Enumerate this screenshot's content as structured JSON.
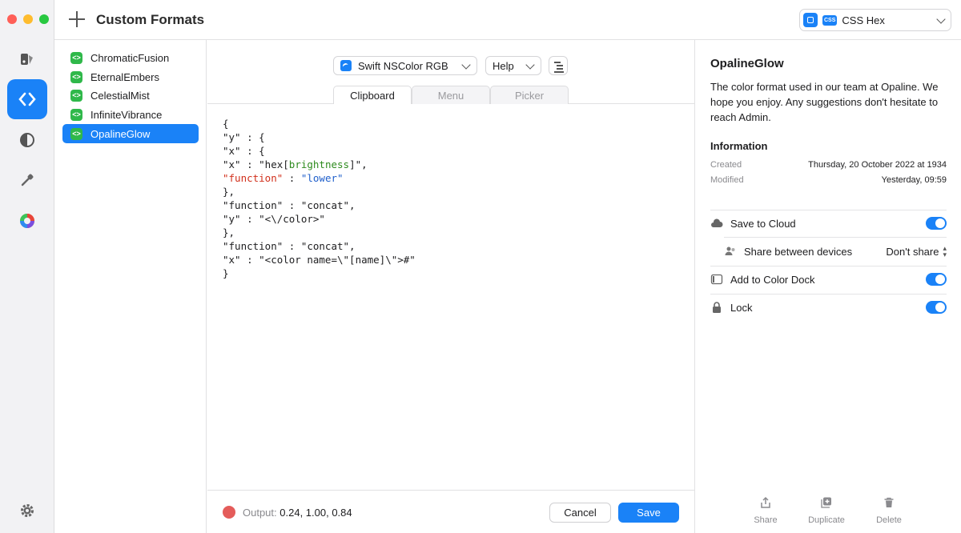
{
  "window": {
    "header_title": "Custom Formats",
    "format_select": {
      "badge": "CSS",
      "label": "CSS Hex"
    }
  },
  "rail": {
    "items": [
      {
        "icon": "paint-bucket-icon",
        "active": false
      },
      {
        "icon": "code-brackets-icon",
        "active": true
      },
      {
        "icon": "contrast-icon",
        "active": false
      },
      {
        "icon": "eyedropper-icon",
        "active": false
      },
      {
        "icon": "color-wheel-icon",
        "active": false
      }
    ],
    "settings_icon": "gear-icon"
  },
  "formats": [
    {
      "name": "ChromaticFusion",
      "selected": false
    },
    {
      "name": "EternalEmbers",
      "selected": false
    },
    {
      "name": "CelestialMist",
      "selected": false
    },
    {
      "name": "InfiniteVibrance",
      "selected": false
    },
    {
      "name": "OpalineGlow",
      "selected": true
    }
  ],
  "editor": {
    "language_select": "Swift NSColor RGB",
    "help_select": "Help",
    "tabs": [
      "Clipboard",
      "Menu",
      "Picker"
    ],
    "active_tab": "Clipboard",
    "code": {
      "l1": "{",
      "l2": "\"y\" : {",
      "l3": "\"x\" : {",
      "l4a": "\"x\" : \"hex[",
      "l4b": "brightness",
      "l4c": "]\",",
      "l5a": "\"function\"",
      "l5b": " : ",
      "l5c": "\"lower\"",
      "l6": "},",
      "l7": "\"function\" : \"concat\",",
      "l8": "\"y\" : \"<\\/color>\"",
      "l9": "},",
      "l10": "\"function\" : \"concat\",",
      "l11": "\"x\" : \"<color name=\\\"[name]\\\">#\"",
      "l12": "}"
    },
    "output_label": "Output:",
    "output_value": "0.24, 1.00, 0.84",
    "swatch_color": "#e45c5a",
    "cancel_label": "Cancel",
    "save_label": "Save"
  },
  "inspector": {
    "title": "OpalineGlow",
    "description": "The color format used in our team at Opaline. We hope you enjoy. Any suggestions don't hesitate to reach Admin.",
    "info_heading": "Information",
    "created_label": "Created",
    "created_value": "Thursday, 20 October 2022 at 1934",
    "modified_label": "Modified",
    "modified_value": "Yesterday, 09:59",
    "save_to_cloud": "Save to Cloud",
    "share_between_devices": "Share between devices",
    "share_value": "Don't share",
    "add_to_dock": "Add to Color Dock",
    "lock": "Lock",
    "actions": {
      "share": "Share",
      "duplicate": "Duplicate",
      "delete": "Delete"
    }
  },
  "colors": {
    "accent": "#1a82f7",
    "format_icon": "#2fb84a"
  }
}
